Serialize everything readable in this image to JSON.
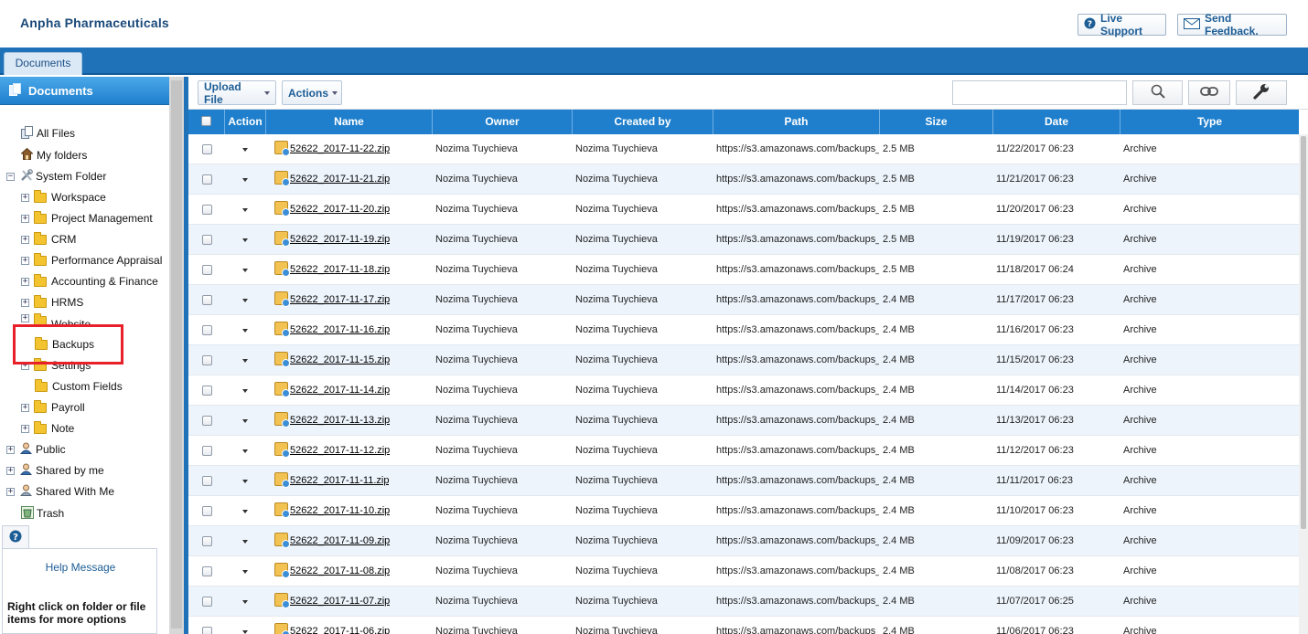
{
  "app": {
    "title": "Anpha Pharmaceuticals"
  },
  "header": {
    "live_support": "Live Support",
    "send_feedback": "Send Feedback."
  },
  "tabs": [
    {
      "label": "Documents"
    }
  ],
  "sidebar": {
    "title": "Documents",
    "items": [
      {
        "label": "All Files"
      },
      {
        "label": "My folders"
      },
      {
        "label": "System Folder"
      },
      {
        "label": "Workspace"
      },
      {
        "label": "Project Management"
      },
      {
        "label": "CRM"
      },
      {
        "label": "Performance Appraisal"
      },
      {
        "label": "Accounting & Finance"
      },
      {
        "label": "HRMS"
      },
      {
        "label": "Website"
      },
      {
        "label": "Backups"
      },
      {
        "label": "Settings"
      },
      {
        "label": "Custom Fields"
      },
      {
        "label": "Payroll"
      },
      {
        "label": "Note"
      },
      {
        "label": "Public"
      },
      {
        "label": "Shared by me"
      },
      {
        "label": "Shared With Me"
      },
      {
        "label": "Trash"
      }
    ]
  },
  "help": {
    "title": "Help Message",
    "message": "Right click on folder or file items for more options"
  },
  "toolbar": {
    "upload_label": "Upload File",
    "actions_label": "Actions",
    "search_placeholder": ""
  },
  "grid": {
    "columns": [
      "Action",
      "Name",
      "Owner",
      "Created by",
      "Path",
      "Size",
      "Date",
      "Type"
    ],
    "rows": [
      {
        "name": "52622_2017-11-22.zip",
        "owner": "Nozima Tuychieva",
        "created_by": "Nozima Tuychieva",
        "path": "https://s3.amazonaws.com/backups_",
        "size": "2.5 MB",
        "date": "11/22/2017 06:23",
        "type": "Archive"
      },
      {
        "name": "52622_2017-11-21.zip",
        "owner": "Nozima Tuychieva",
        "created_by": "Nozima Tuychieva",
        "path": "https://s3.amazonaws.com/backups_",
        "size": "2.5 MB",
        "date": "11/21/2017 06:23",
        "type": "Archive"
      },
      {
        "name": "52622_2017-11-20.zip",
        "owner": "Nozima Tuychieva",
        "created_by": "Nozima Tuychieva",
        "path": "https://s3.amazonaws.com/backups_",
        "size": "2.5 MB",
        "date": "11/20/2017 06:23",
        "type": "Archive"
      },
      {
        "name": "52622_2017-11-19.zip",
        "owner": "Nozima Tuychieva",
        "created_by": "Nozima Tuychieva",
        "path": "https://s3.amazonaws.com/backups_",
        "size": "2.5 MB",
        "date": "11/19/2017 06:23",
        "type": "Archive"
      },
      {
        "name": "52622_2017-11-18.zip",
        "owner": "Nozima Tuychieva",
        "created_by": "Nozima Tuychieva",
        "path": "https://s3.amazonaws.com/backups_",
        "size": "2.5 MB",
        "date": "11/18/2017 06:24",
        "type": "Archive"
      },
      {
        "name": "52622_2017-11-17.zip",
        "owner": "Nozima Tuychieva",
        "created_by": "Nozima Tuychieva",
        "path": "https://s3.amazonaws.com/backups_",
        "size": "2.4 MB",
        "date": "11/17/2017 06:23",
        "type": "Archive"
      },
      {
        "name": "52622_2017-11-16.zip",
        "owner": "Nozima Tuychieva",
        "created_by": "Nozima Tuychieva",
        "path": "https://s3.amazonaws.com/backups_",
        "size": "2.4 MB",
        "date": "11/16/2017 06:23",
        "type": "Archive"
      },
      {
        "name": "52622_2017-11-15.zip",
        "owner": "Nozima Tuychieva",
        "created_by": "Nozima Tuychieva",
        "path": "https://s3.amazonaws.com/backups_",
        "size": "2.4 MB",
        "date": "11/15/2017 06:23",
        "type": "Archive"
      },
      {
        "name": "52622_2017-11-14.zip",
        "owner": "Nozima Tuychieva",
        "created_by": "Nozima Tuychieva",
        "path": "https://s3.amazonaws.com/backups_",
        "size": "2.4 MB",
        "date": "11/14/2017 06:23",
        "type": "Archive"
      },
      {
        "name": "52622_2017-11-13.zip",
        "owner": "Nozima Tuychieva",
        "created_by": "Nozima Tuychieva",
        "path": "https://s3.amazonaws.com/backups_",
        "size": "2.4 MB",
        "date": "11/13/2017 06:23",
        "type": "Archive"
      },
      {
        "name": "52622_2017-11-12.zip",
        "owner": "Nozima Tuychieva",
        "created_by": "Nozima Tuychieva",
        "path": "https://s3.amazonaws.com/backups_",
        "size": "2.4 MB",
        "date": "11/12/2017 06:23",
        "type": "Archive"
      },
      {
        "name": "52622_2017-11-11.zip",
        "owner": "Nozima Tuychieva",
        "created_by": "Nozima Tuychieva",
        "path": "https://s3.amazonaws.com/backups_",
        "size": "2.4 MB",
        "date": "11/11/2017 06:23",
        "type": "Archive"
      },
      {
        "name": "52622_2017-11-10.zip",
        "owner": "Nozima Tuychieva",
        "created_by": "Nozima Tuychieva",
        "path": "https://s3.amazonaws.com/backups_",
        "size": "2.4 MB",
        "date": "11/10/2017 06:23",
        "type": "Archive"
      },
      {
        "name": "52622_2017-11-09.zip",
        "owner": "Nozima Tuychieva",
        "created_by": "Nozima Tuychieva",
        "path": "https://s3.amazonaws.com/backups_",
        "size": "2.4 MB",
        "date": "11/09/2017 06:23",
        "type": "Archive"
      },
      {
        "name": "52622_2017-11-08.zip",
        "owner": "Nozima Tuychieva",
        "created_by": "Nozima Tuychieva",
        "path": "https://s3.amazonaws.com/backups_",
        "size": "2.4 MB",
        "date": "11/08/2017 06:23",
        "type": "Archive"
      },
      {
        "name": "52622_2017-11-07.zip",
        "owner": "Nozima Tuychieva",
        "created_by": "Nozima Tuychieva",
        "path": "https://s3.amazonaws.com/backups_",
        "size": "2.4 MB",
        "date": "11/07/2017 06:25",
        "type": "Archive"
      },
      {
        "name": "52622_2017-11-06.zip",
        "owner": "Nozima Tuychieva",
        "created_by": "Nozima Tuychieva",
        "path": "https://s3.amazonaws.com/backups_",
        "size": "2.4 MB",
        "date": "11/06/2017 06:23",
        "type": "Archive"
      }
    ]
  },
  "colors": {
    "accent": "#1f7fcc",
    "tabbar": "#1f72b8",
    "row_alt": "#edf4fc",
    "highlight": "#e8202a"
  }
}
